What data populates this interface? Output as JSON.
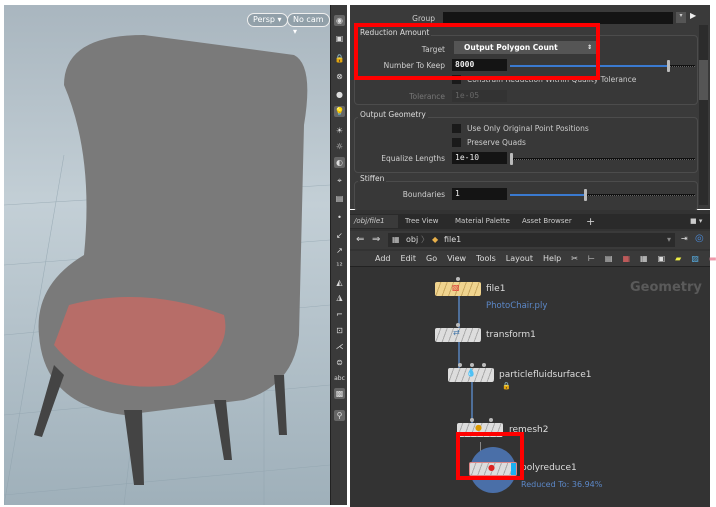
{
  "viewport": {
    "persp_label": "Persp ▾",
    "cam_label": "No cam ▾"
  },
  "params": {
    "group_label": "Group",
    "reduction": {
      "title": "Reduction Amount",
      "target_label": "Target",
      "target_value": "Output Polygon Count",
      "keep_label": "Number To Keep",
      "keep_value": "8000",
      "keep_slider_fraction": 0.85,
      "constrain_label": "Constrain Reduction Within Quality Tolerance",
      "tolerance_label": "Tolerance",
      "tolerance_value": "1e-05"
    },
    "output": {
      "title": "Output Geometry",
      "orig_points_label": "Use Only Original Point Positions",
      "quads_label": "Preserve Quads",
      "equalize_label": "Equalize Lengths",
      "equalize_value": "1e-10"
    },
    "stiffen": {
      "title": "Stiffen",
      "boundaries_label": "Boundaries",
      "boundaries_value": "1",
      "boundaries_slider_fraction": 0.4
    }
  },
  "network": {
    "tabs": [
      "/obj/file1",
      "Tree View",
      "Material Palette",
      "Asset Browser"
    ],
    "path": [
      "obj",
      "file1"
    ],
    "menu": [
      "Add",
      "Edit",
      "Go",
      "View",
      "Tools",
      "Layout",
      "Help"
    ],
    "context_label": "Geometry",
    "nodes": [
      {
        "name": "file1",
        "sub": "PhotoChair.ply"
      },
      {
        "name": "transform1"
      },
      {
        "name": "particlefluidsurface1"
      },
      {
        "name": "remesh2"
      },
      {
        "name": "polyreduce1",
        "sub": "Reduced To: 36.94%"
      }
    ]
  },
  "colors": {
    "highlight": "#ff0000",
    "accent": "#3a7ad0"
  }
}
